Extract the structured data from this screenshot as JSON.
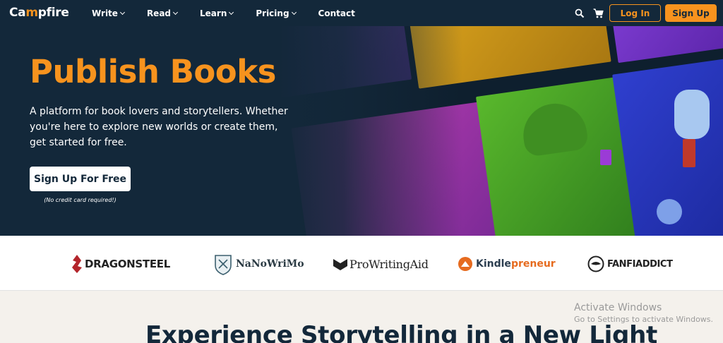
{
  "nav": {
    "logo": "Campfire",
    "items": [
      {
        "label": "Write",
        "has_dropdown": true
      },
      {
        "label": "Read",
        "has_dropdown": true
      },
      {
        "label": "Learn",
        "has_dropdown": true
      },
      {
        "label": "Pricing",
        "has_dropdown": true
      },
      {
        "label": "Contact",
        "has_dropdown": false
      }
    ],
    "icons": [
      "search-icon",
      "cart-icon"
    ],
    "login_label": "Log In",
    "signup_label": "Sign Up"
  },
  "hero": {
    "title": "Publish Books",
    "subtitle": "A platform for book lovers and storytellers. Whether you're here to explore new worlds or create them, get started for free.",
    "cta_label": "Sign Up For Free",
    "cta_note": "(No credit card required!)"
  },
  "partners": [
    {
      "name": "DRAGONSTEEL"
    },
    {
      "name": "NaNoWriMo"
    },
    {
      "name": "ProWritingAid"
    },
    {
      "name_part1": "Kindle",
      "name_part2": "preneur"
    },
    {
      "name": "FANFIADDICT"
    }
  ],
  "section": {
    "heading": "Experience Storytelling in a New Light"
  },
  "watermark": {
    "line1": "Activate Windows",
    "line2": "Go to Settings to activate Windows."
  },
  "colors": {
    "navy": "#13283a",
    "accent": "#f7931e",
    "cream": "#f4f1ec"
  }
}
